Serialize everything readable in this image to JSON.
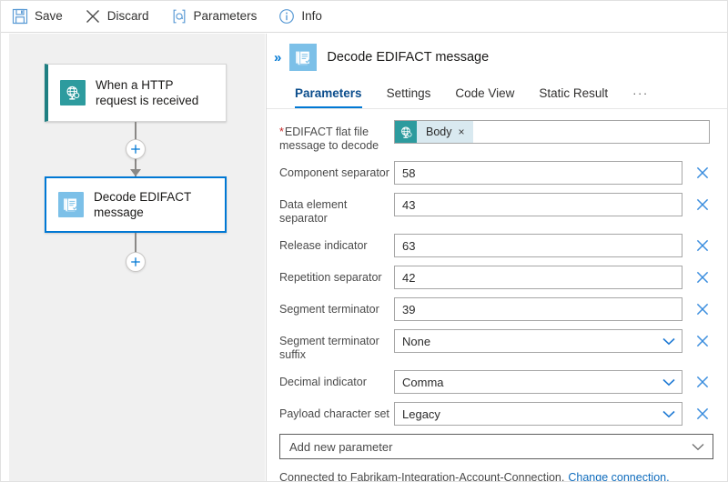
{
  "toolbar": {
    "buttons": [
      {
        "label": "Save",
        "icon": "save-icon"
      },
      {
        "label": "Discard",
        "icon": "discard-icon"
      },
      {
        "label": "Parameters",
        "icon": "parameters-icon"
      },
      {
        "label": "Info",
        "icon": "info-icon"
      }
    ]
  },
  "canvas": {
    "trigger_card": {
      "title": "When a HTTP request is received",
      "icon": "http-request-icon",
      "accent_color": "#1f7f82"
    },
    "action_card": {
      "title": "Decode EDIFACT message",
      "icon": "decode-edifact-icon",
      "selected_color": "#0078d4"
    },
    "add_step_buttons": [
      {
        "label": "+",
        "name": "add-step-between"
      },
      {
        "label": "+",
        "name": "add-step-after"
      }
    ]
  },
  "panel": {
    "collapse_icon": "»",
    "title": "Decode EDIFACT message",
    "icon": "decode-edifact-icon",
    "tabs": [
      {
        "label": "Parameters",
        "active": true
      },
      {
        "label": "Settings",
        "active": false
      },
      {
        "label": "Code View",
        "active": false
      },
      {
        "label": "Static Result",
        "active": false
      }
    ],
    "tabs_overflow": "···",
    "fields": [
      {
        "label": "EDIFACT flat file message to decode",
        "required": true,
        "type": "token",
        "token": {
          "text": "Body",
          "icon": "http-request-icon",
          "remove": "×"
        },
        "deletable": false
      },
      {
        "label": "Component separator",
        "required": false,
        "type": "text",
        "value": "58",
        "deletable": true
      },
      {
        "label": "Data element separator",
        "required": false,
        "type": "text",
        "value": "43",
        "deletable": true
      },
      {
        "label": "Release indicator",
        "required": false,
        "type": "text",
        "value": "63",
        "deletable": true
      },
      {
        "label": "Repetition separator",
        "required": false,
        "type": "text",
        "value": "42",
        "deletable": true
      },
      {
        "label": "Segment terminator",
        "required": false,
        "type": "text",
        "value": "39",
        "deletable": true
      },
      {
        "label": "Segment terminator suffix",
        "required": false,
        "type": "select",
        "value": "None",
        "deletable": true
      },
      {
        "label": "Decimal indicator",
        "required": false,
        "type": "select",
        "value": "Comma",
        "deletable": true
      },
      {
        "label": "Payload character set",
        "required": false,
        "type": "select",
        "value": "Legacy",
        "deletable": true
      }
    ],
    "add_parameter": {
      "label": "Add new parameter"
    },
    "connection": {
      "text": "Connected to Fabrikam-Integration-Account-Connection.",
      "link": "Change connection."
    }
  },
  "colors": {
    "accent_blue": "#0078d4",
    "teal": "#2d9b9e",
    "light_blue": "#7cc0e8",
    "canvas_bg": "#f0f0f0",
    "required_red": "#c62828"
  }
}
